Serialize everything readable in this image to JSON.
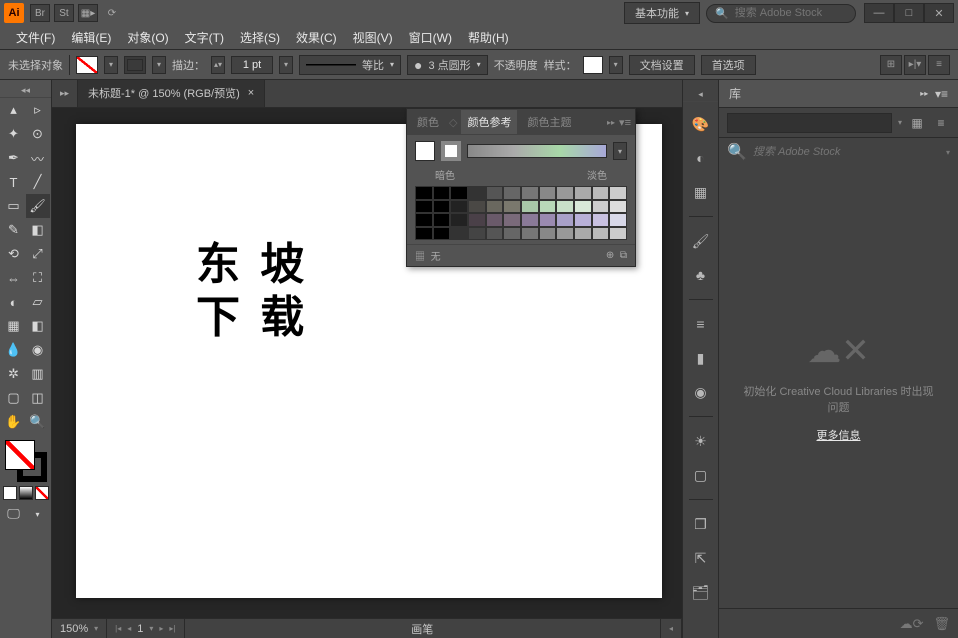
{
  "titlebar": {
    "logo": "Ai",
    "badges": [
      "Br",
      "St"
    ],
    "workspace": "基本功能",
    "search_placeholder": "搜索 Adobe Stock"
  },
  "menu": [
    "文件(F)",
    "编辑(E)",
    "对象(O)",
    "文字(T)",
    "选择(S)",
    "效果(C)",
    "视图(V)",
    "窗口(W)",
    "帮助(H)"
  ],
  "control": {
    "selection": "未选择对象",
    "stroke_label": "描边：",
    "stroke_weight": "1 pt",
    "uniform": "等比",
    "brush_preset": "3 点圆形",
    "opacity_label": "不透明度",
    "style_label": "样式：",
    "doc_setup": "文档设置",
    "prefs": "首选项"
  },
  "document": {
    "tab_title": "未标题-1* @ 150% (RGB/预览)",
    "art_line1": "东 坡",
    "art_line2": "下 载"
  },
  "status": {
    "zoom": "150%",
    "page": "1",
    "tool": "画笔"
  },
  "color_panel": {
    "tabs": [
      "颜色",
      "颜色参考",
      "颜色主题"
    ],
    "dark_label": "暗色",
    "light_label": "淡色",
    "none_label": "无",
    "grid": [
      "#000",
      "#000",
      "#000",
      "#333",
      "#555",
      "#666",
      "#777",
      "#888",
      "#999",
      "#aaa",
      "#bbb",
      "#ccc",
      "#000",
      "#000",
      "#222",
      "#4a4845",
      "#6a685f",
      "#7a786d",
      "#a8c8a8",
      "#b8d8b8",
      "#c8e0c8",
      "#d8e8d8",
      "#ccc",
      "#ddd",
      "#000",
      "#000",
      "#222",
      "#4a4048",
      "#6a5a6a",
      "#7a6a7a",
      "#8a7a98",
      "#9a8ab0",
      "#a8a0c8",
      "#b8b0d8",
      "#c8c0e0",
      "#d8d8e8",
      "#000",
      "#000",
      "#333",
      "#444",
      "#555",
      "#666",
      "#777",
      "#888",
      "#999",
      "#aaa",
      "#bbb",
      "#ccc"
    ]
  },
  "library": {
    "title": "库",
    "search_placeholder": "搜索 Adobe Stock",
    "error_msg": "初始化 Creative Cloud Libraries 时出现问题",
    "more_info": "更多信息"
  },
  "tools": [
    [
      "selection",
      "direct-selection"
    ],
    [
      "magic-wand",
      "lasso"
    ],
    [
      "pen",
      "curvature"
    ],
    [
      "type",
      "line"
    ],
    [
      "rectangle",
      "brush"
    ],
    [
      "pencil",
      "eraser"
    ],
    [
      "rotate",
      "scale"
    ],
    [
      "width",
      "free-transform"
    ],
    [
      "shape-builder",
      "perspective"
    ],
    [
      "mesh",
      "gradient"
    ],
    [
      "eyedropper",
      "blend"
    ],
    [
      "symbol-sprayer",
      "graph"
    ],
    [
      "artboard",
      "slice"
    ],
    [
      "hand",
      "zoom"
    ]
  ],
  "rail_icons": [
    "palette",
    "color-guide",
    "swatches",
    "sep",
    "brushes",
    "symbols",
    "sep",
    "stroke",
    "gradient",
    "transparency",
    "sep",
    "appearance",
    "graphic-styles",
    "sep",
    "layers",
    "asset-export",
    "artboards"
  ]
}
